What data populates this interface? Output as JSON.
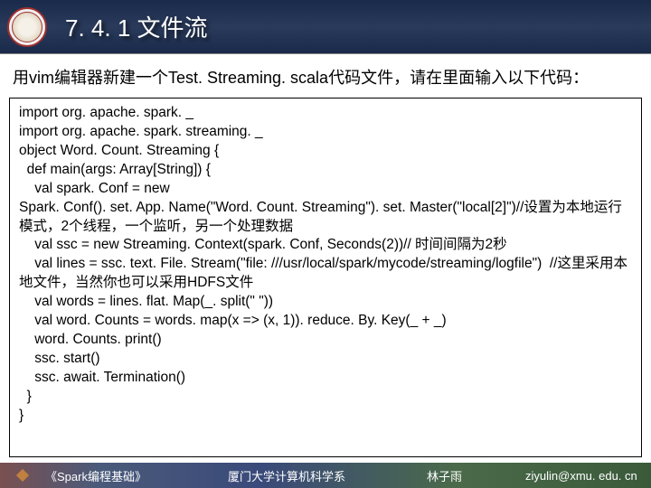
{
  "header": {
    "title": "7. 4. 1 文件流"
  },
  "instruction": "用vim编辑器新建一个Test. Streaming. scala代码文件，请在里面输入以下代码：",
  "code": {
    "lines": [
      "import org. apache. spark. _",
      "import org. apache. spark. streaming. _",
      "object Word. Count. Streaming {",
      "  def main(args: Array[String]) {",
      "    val spark. Conf = new",
      "Spark. Conf(). set. App. Name(\"Word. Count. Streaming\"). set. Master(\"local[2]\")//设置为本地运行模式，2个线程，一个监听，另一个处理数据",
      "    val ssc = new Streaming. Context(spark. Conf, Seconds(2))// 时间间隔为2秒",
      "    val lines = ssc. text. File. Stream(\"file: ///usr/local/spark/mycode/streaming/logfile\")  //这里采用本地文件，当然你也可以采用HDFS文件",
      "    val words = lines. flat. Map(_. split(\" \"))",
      "    val word. Counts = words. map(x => (x, 1)). reduce. By. Key(_ + _)",
      "    word. Counts. print()",
      "    ssc. start()",
      "    ssc. await. Termination()",
      "  }",
      "}"
    ]
  },
  "footer": {
    "book": "《Spark编程基础》",
    "dept": "厦门大学计算机科学系",
    "author": "林子雨",
    "email": "ziyulin@xmu. edu. cn"
  }
}
